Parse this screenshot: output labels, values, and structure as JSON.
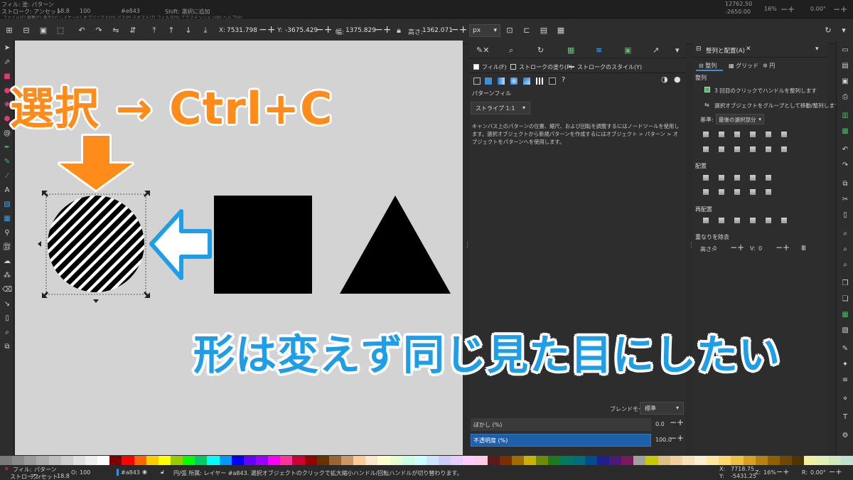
{
  "top_strip": {
    "fill_label": "フィル: 塗:",
    "fill_value": "パターン",
    "stroke_label": "ストローク: アンセット",
    "width_value": "18.8",
    "menu": [
      "ファイル(F)",
      "編集(E)",
      "表示(V)",
      "レイヤー(L)",
      "オブジェクト(O)",
      "パス(P)",
      "テキスト(T)",
      "フィルタ(S)",
      "エクステンション(N)",
      "ヘルプ(H)"
    ],
    "opacity_value": "100",
    "color_hex": "#e843",
    "hint": "Shift: 選択に追加",
    "x_readout": "12762.50",
    "y_readout": "-2650.00",
    "zoom": "16%",
    "rotation": "0.00°"
  },
  "command_bar": {
    "x_label": "X:",
    "x_value": "7531.798",
    "y_label": "Y:",
    "y_value": "-3675.429",
    "w_label": "幅:",
    "w_value": "1375.829",
    "h_label": "高さ:",
    "h_value": "1362.071",
    "unit": "px"
  },
  "fill_panel": {
    "subtabs": [
      "フィル(F)",
      "ストロークの塗り(P)",
      "ストロークのスタイル(Y)"
    ],
    "help_icon": "?",
    "pattern_fill_label": "パターンフィル",
    "pattern_selected": "ストライプ 1:1",
    "help_text": "キャンバス上のパターンの位置、縮尺、および回転を調整するにはノードツールを使用します。選択オブジェクトから新規パターンを作成するにはオブジェクト > パターン > オブジェクトをパターンへを使用します。",
    "blend_mode_label": "ブレンドモード",
    "blend_mode_value": "標準",
    "blur_label": "ぼかし (%)",
    "blur_value": "0.0",
    "opacity_label": "不透明度 (%)",
    "opacity_value": "100.0",
    "opacity_level": 1.0,
    "accent": "#1f5fa8"
  },
  "align_panel": {
    "title": "整列と配置(A)",
    "tabs": [
      "整列",
      "グリッド",
      "円"
    ],
    "section_align": "整列",
    "line1": "3 回目のクリックでハンドルを整列します",
    "line2": "選択オブジェクトをグループとして移動/整列します",
    "ref_label": "基準:",
    "ref_value": "最後の選択部分",
    "section_distribute": "配置",
    "section_rearrange": "再配置",
    "section_remove_overlap": "重なりを除去",
    "h_gap_label": "高さ:",
    "h_gap_value": "0",
    "v_gap_label": "V:",
    "v_gap_value": "0"
  },
  "status": {
    "fill_label": "フィル:",
    "fill_value": "パターン",
    "stroke_label": "ストローク:",
    "stroke_value": "アンセット",
    "o_label": "O:",
    "o_value": "100",
    "width": "18.8",
    "color": "#a843",
    "message": "円/弧 所属: レイヤー #a843. 選択オブジェクトのクリックで拡大縮小ハンドル/回転ハンドルが切り替わります。",
    "x_label": "X:",
    "x_value": "7718.75",
    "y_label": "Y:",
    "y_value": "-5431.25",
    "z_label": "Z:",
    "zoom": "16%",
    "r_label": "R:",
    "rotation": "0.00°"
  },
  "captions": {
    "select_copy": "選択 → Ctrl+C",
    "keep_shape": "形は変えず同じ見た目にしたい"
  },
  "colors": {
    "canvas_bg": "#d3d3d3",
    "orange": "#ff8c1a",
    "blue": "#1f9ee8",
    "shape": "#000000"
  },
  "palette": [
    "#7a7a7a",
    "#8a8a8a",
    "#9b9b9b",
    "#acacac",
    "#bdbdbd",
    "#cecece",
    "#dfdfdf",
    "#efefef",
    "#ffffff",
    "#800000",
    "#ff0000",
    "#ff6600",
    "#ffcc00",
    "#ffff00",
    "#99cc00",
    "#00ff00",
    "#00cc66",
    "#00ffff",
    "#0099ff",
    "#0000ff",
    "#6600ff",
    "#9900ff",
    "#ff00ff",
    "#ff3399",
    "#cc0033",
    "#990000",
    "#663300",
    "#996633",
    "#cc9966",
    "#ffcc99",
    "#ffe6cc",
    "#ffffcc",
    "#e6ffcc",
    "#ccffe6",
    "#ccffff",
    "#cce6ff",
    "#ccccff",
    "#e6ccff",
    "#ffccff",
    "#ffcce6",
    "#5c1a1a",
    "#7a2e00",
    "#a36b00",
    "#c8b400",
    "#6e8c00",
    "#1e7a1e",
    "#007a5c",
    "#006e7a",
    "#004c8c",
    "#1e1e8c",
    "#4c1a7a",
    "#7a1a5c",
    "#a0a0a0",
    "#c8c800",
    "#e0c080",
    "#f0d0a0",
    "#f6e2b8",
    "#fbeed2",
    "#ffe8a0",
    "#ffd870",
    "#f0c040",
    "#d8a020",
    "#b88010",
    "#906000",
    "#6c4800",
    "#503400",
    "#f0f0a0",
    "#e0f0b0",
    "#d0e8c0",
    "#c0e0d0"
  ]
}
